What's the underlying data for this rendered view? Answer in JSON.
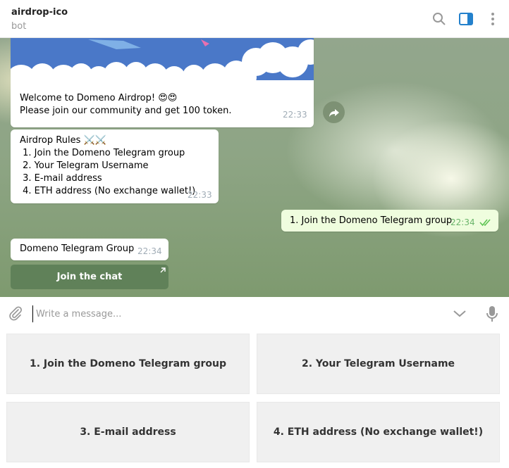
{
  "header": {
    "title": "airdrop-ico",
    "subtitle": "bot"
  },
  "messages": {
    "welcome": {
      "line1": "Welcome to Domeno Airdrop! 😍😍",
      "line2": "Please join our community and get 100 token.",
      "time": "22:33"
    },
    "rules": {
      "title": "Airdrop Rules ⚔️⚔️",
      "items": [
        " 1. Join the Domeno Telegram group",
        " 2. Your Telegram Username",
        " 3. E-mail address",
        " 4. ETH address (No exchange wallet!)"
      ],
      "time": "22:33"
    },
    "outgoing": {
      "text": "1. Join the Domeno Telegram group",
      "time": "22:34"
    },
    "group": {
      "text": "Domeno Telegram Group",
      "time": "22:34",
      "button_label": "Join the chat"
    }
  },
  "composer": {
    "placeholder": "Write a message..."
  },
  "keyboard": {
    "buttons": [
      "1. Join the Domeno Telegram group",
      "2. Your Telegram Username",
      "3. E-mail address",
      "4. ETH address (No exchange wallet!)"
    ]
  },
  "colors": {
    "accent": "#2481cc",
    "outgoing_bubble": "#effdde",
    "read_check": "#5dc452"
  }
}
